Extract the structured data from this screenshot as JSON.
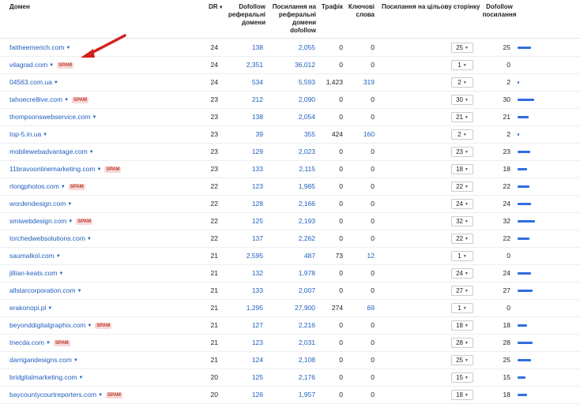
{
  "columns": {
    "domain": "Домен",
    "dr": "DR",
    "ref_domains": "Dofollow\nреферальні\nдомени",
    "backlinks": "Посилання на\nреферальні\nдомени\ndofollow",
    "traffic": "Трафік",
    "keywords": "Ключові\nслова",
    "links_to_target": "Посилання на цільову сторінку",
    "dofollow_links": "Dofollow\nпосилання"
  },
  "spam_label": "SPAM",
  "rows": [
    {
      "domain": "faitheemerich.com",
      "spam": false,
      "dr": "24",
      "ref": "138",
      "links": "2,055",
      "traffic": "0",
      "kw": "0",
      "target": "25",
      "dofollow": "25"
    },
    {
      "domain": "vilagrad.com",
      "spam": true,
      "dr": "24",
      "ref": "2,351",
      "links": "36,012",
      "traffic": "0",
      "kw": "0",
      "target": "1",
      "dofollow": "0"
    },
    {
      "domain": "04563.com.ua",
      "spam": false,
      "dr": "24",
      "ref": "534",
      "links": "5,593",
      "traffic": "1,423",
      "kw": "319",
      "target": "2",
      "dofollow": "2"
    },
    {
      "domain": "tahoecre8ive.com",
      "spam": true,
      "dr": "23",
      "ref": "212",
      "links": "2,090",
      "traffic": "0",
      "kw": "0",
      "target": "30",
      "dofollow": "30"
    },
    {
      "domain": "thompsonswebservice.com",
      "spam": false,
      "dr": "23",
      "ref": "138",
      "links": "2,054",
      "traffic": "0",
      "kw": "0",
      "target": "21",
      "dofollow": "21"
    },
    {
      "domain": "top-5.in.ua",
      "spam": false,
      "dr": "23",
      "ref": "39",
      "links": "355",
      "traffic": "424",
      "kw": "160",
      "target": "2",
      "dofollow": "2"
    },
    {
      "domain": "mobilewebadvantage.com",
      "spam": false,
      "dr": "23",
      "ref": "129",
      "links": "2,023",
      "traffic": "0",
      "kw": "0",
      "target": "23",
      "dofollow": "23"
    },
    {
      "domain": "11bravoonlinemarketing.com",
      "spam": true,
      "dr": "23",
      "ref": "133",
      "links": "2,115",
      "traffic": "0",
      "kw": "0",
      "target": "18",
      "dofollow": "18"
    },
    {
      "domain": "rlongphotos.com",
      "spam": true,
      "dr": "22",
      "ref": "123",
      "links": "1,985",
      "traffic": "0",
      "kw": "0",
      "target": "22",
      "dofollow": "22"
    },
    {
      "domain": "wordendesign.com",
      "spam": false,
      "dr": "22",
      "ref": "128",
      "links": "2,166",
      "traffic": "0",
      "kw": "0",
      "target": "24",
      "dofollow": "24"
    },
    {
      "domain": "smiwebdesign.com",
      "spam": true,
      "dr": "22",
      "ref": "125",
      "links": "2,193",
      "traffic": "0",
      "kw": "0",
      "target": "32",
      "dofollow": "32"
    },
    {
      "domain": "torchedwebsolutions.com",
      "spam": false,
      "dr": "22",
      "ref": "137",
      "links": "2,262",
      "traffic": "0",
      "kw": "0",
      "target": "22",
      "dofollow": "22"
    },
    {
      "domain": "saumalkol.com",
      "spam": false,
      "dr": "21",
      "ref": "2,595",
      "links": "487",
      "traffic": "73",
      "kw": "12",
      "target": "1",
      "dofollow": "0"
    },
    {
      "domain": "jillian-keats.com",
      "spam": false,
      "dr": "21",
      "ref": "132",
      "links": "1,978",
      "traffic": "0",
      "kw": "0",
      "target": "24",
      "dofollow": "24"
    },
    {
      "domain": "allstarcorporation.com",
      "spam": false,
      "dr": "21",
      "ref": "133",
      "links": "2,007",
      "traffic": "0",
      "kw": "0",
      "target": "27",
      "dofollow": "27"
    },
    {
      "domain": "erakonopi.pl",
      "spam": false,
      "dr": "21",
      "ref": "1,295",
      "links": "27,900",
      "traffic": "274",
      "kw": "69",
      "target": "1",
      "dofollow": "0"
    },
    {
      "domain": "beyonddigitalgraphix.com",
      "spam": true,
      "dr": "21",
      "ref": "127",
      "links": "2,216",
      "traffic": "0",
      "kw": "0",
      "target": "18",
      "dofollow": "18"
    },
    {
      "domain": "tnecda.com",
      "spam": true,
      "dr": "21",
      "ref": "123",
      "links": "2,031",
      "traffic": "0",
      "kw": "0",
      "target": "28",
      "dofollow": "28"
    },
    {
      "domain": "darrigandesigns.com",
      "spam": false,
      "dr": "21",
      "ref": "124",
      "links": "2,108",
      "traffic": "0",
      "kw": "0",
      "target": "25",
      "dofollow": "25"
    },
    {
      "domain": "bridgitalmarketing.com",
      "spam": false,
      "dr": "20",
      "ref": "125",
      "links": "2,176",
      "traffic": "0",
      "kw": "0",
      "target": "15",
      "dofollow": "15"
    },
    {
      "domain": "baycountycourtreporters.com",
      "spam": true,
      "dr": "20",
      "ref": "126",
      "links": "1,957",
      "traffic": "0",
      "kw": "0",
      "target": "18",
      "dofollow": "18"
    }
  ],
  "colors": {
    "link": "#1f5fbf",
    "bar": "#2f6ee0",
    "spam_bg": "#f7d9d9",
    "spam_text": "#c0392b",
    "arrow": "#d42020"
  }
}
